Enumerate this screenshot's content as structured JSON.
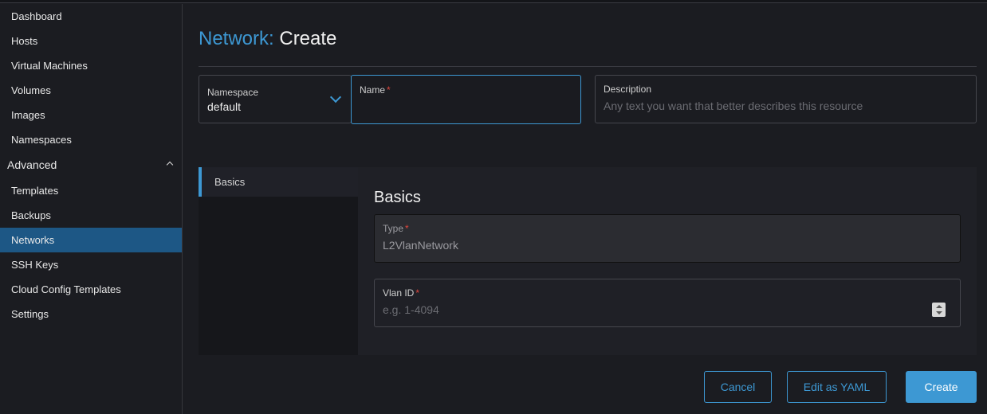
{
  "sidebar": {
    "items": [
      {
        "label": "Dashboard"
      },
      {
        "label": "Hosts"
      },
      {
        "label": "Virtual Machines"
      },
      {
        "label": "Volumes"
      },
      {
        "label": "Images"
      },
      {
        "label": "Namespaces"
      }
    ],
    "group_label": "Advanced",
    "advanced_items": [
      {
        "label": "Templates"
      },
      {
        "label": "Backups"
      },
      {
        "label": "Networks",
        "active": true
      },
      {
        "label": "SSH Keys"
      },
      {
        "label": "Cloud Config Templates"
      },
      {
        "label": "Settings"
      }
    ]
  },
  "header": {
    "resource": "Network:",
    "action": "Create"
  },
  "form": {
    "namespace": {
      "label": "Namespace",
      "value": "default"
    },
    "name": {
      "label": "Name",
      "required_mark": "*",
      "value": ""
    },
    "description": {
      "label": "Description",
      "placeholder": "Any text you want that better describes this resource"
    }
  },
  "tabs": [
    {
      "label": "Basics"
    }
  ],
  "basics": {
    "title": "Basics",
    "type": {
      "label": "Type",
      "required_mark": "*",
      "value": "L2VlanNetwork"
    },
    "vlan": {
      "label": "Vlan ID",
      "required_mark": "*",
      "placeholder": "e.g. 1-4094"
    }
  },
  "buttons": {
    "cancel": "Cancel",
    "edit_yaml": "Edit as YAML",
    "create": "Create"
  },
  "colors": {
    "accent": "#3d98d3",
    "active_nav": "#1d5785",
    "required": "#e0463d",
    "background": "#1b1c21"
  }
}
